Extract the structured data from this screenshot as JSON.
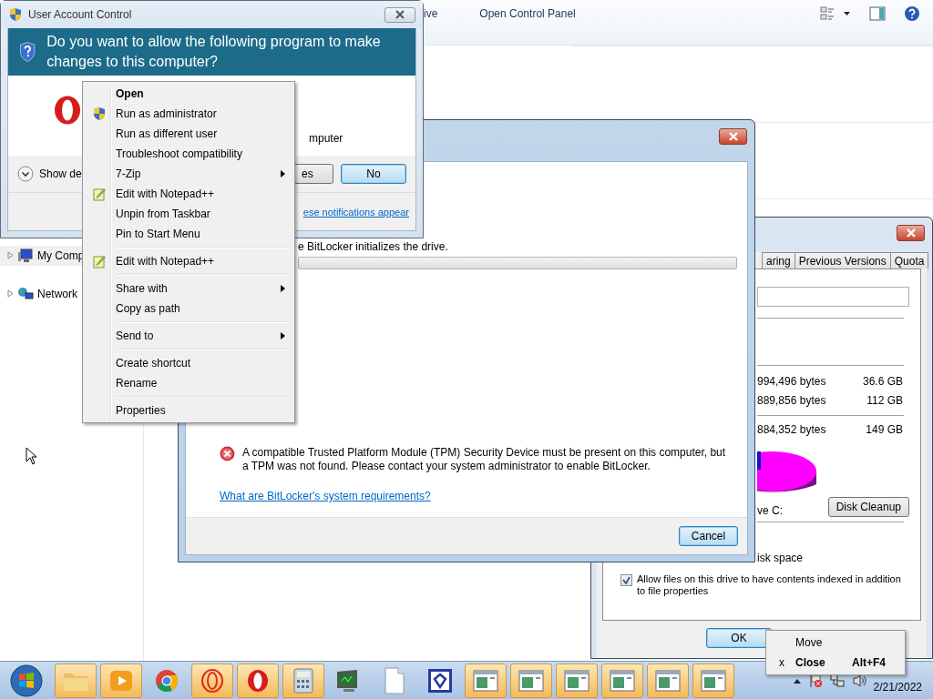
{
  "explorer": {
    "toolbar": [
      "ive",
      "Open Control Panel"
    ],
    "tree": [
      {
        "label": "My Comp",
        "expanded": false,
        "selected": true
      },
      {
        "label": "Network",
        "expanded": false,
        "selected": false
      }
    ]
  },
  "uac": {
    "title": "User Account Control",
    "question": "Do you want to allow the following program to make changes to this computer?",
    "partial_text": "mputer",
    "details": "Show de",
    "buttons": [
      {
        "label": "es",
        "default": false
      },
      {
        "label": "No",
        "default": true
      }
    ],
    "link": "ese notifications appear"
  },
  "context_menu": {
    "groups": [
      [
        {
          "label": "Open",
          "kind": "plain",
          "default": true,
          "submenu": false
        },
        {
          "label": "Run as administrator",
          "kind": "shield",
          "default": false,
          "submenu": false
        },
        {
          "label": "Run as different user",
          "kind": "plain",
          "default": false,
          "submenu": false
        },
        {
          "label": "Troubleshoot compatibility",
          "kind": "plain",
          "default": false,
          "submenu": false
        },
        {
          "label": "7-Zip",
          "kind": "plain",
          "default": false,
          "submenu": true
        },
        {
          "label": "Edit with Notepad++",
          "kind": "notepad",
          "default": false,
          "submenu": false
        },
        {
          "label": "Unpin from Taskbar",
          "kind": "plain",
          "default": false,
          "submenu": false
        },
        {
          "label": "Pin to Start Menu",
          "kind": "plain",
          "default": false,
          "submenu": false
        }
      ],
      [
        {
          "label": "Edit with Notepad++",
          "kind": "notepad",
          "default": false,
          "submenu": false
        }
      ],
      [
        {
          "label": "Share with",
          "kind": "plain",
          "default": false,
          "submenu": true
        },
        {
          "label": "Copy as path",
          "kind": "plain",
          "default": false,
          "submenu": false
        }
      ],
      [
        {
          "label": "Send to",
          "kind": "plain",
          "default": false,
          "submenu": true
        }
      ],
      [
        {
          "label": "Create shortcut",
          "kind": "plain",
          "default": false,
          "submenu": false
        },
        {
          "label": "Rename",
          "kind": "plain",
          "default": false,
          "submenu": false
        }
      ],
      [
        {
          "label": "Properties",
          "kind": "plain",
          "default": false,
          "submenu": false
        }
      ]
    ]
  },
  "bitlocker": {
    "status_text": "e BitLocker initializes the drive.",
    "progress": {
      "level": 0
    },
    "error": "A compatible Trusted Platform Module (TPM) Security Device must be present on this computer, but a TPM was not found. Please contact your system administrator to enable BitLocker.",
    "link": "What are BitLocker's system requirements?",
    "buttons": [
      "Cancel"
    ]
  },
  "properties": {
    "tabs": [
      {
        "label": "aring",
        "selected": false
      },
      {
        "label": "Previous Versions",
        "selected": false
      },
      {
        "label": "Quota",
        "selected": false
      }
    ],
    "rows": [
      {
        "bytes": "994,496 bytes",
        "size": "36.6 GB"
      },
      {
        "bytes": "889,856 bytes",
        "size": "112 GB"
      },
      {
        "bytes": "884,352 bytes",
        "size": "149 GB"
      }
    ],
    "drive_label": "ve C:",
    "cleanup": "Disk Cleanup",
    "partial_option": "isk space",
    "options": [
      {
        "label": "Allow files on this drive to have contents indexed in addition to file properties",
        "checked": true
      }
    ],
    "buttons": [
      "OK"
    ]
  },
  "window_menu": [
    {
      "label": "Move",
      "default": false
    },
    {
      "mark": "x",
      "label": "Close",
      "shortcut": "Alt+F4",
      "default": true
    }
  ],
  "taskbar": {
    "date": "2/21/2022"
  }
}
